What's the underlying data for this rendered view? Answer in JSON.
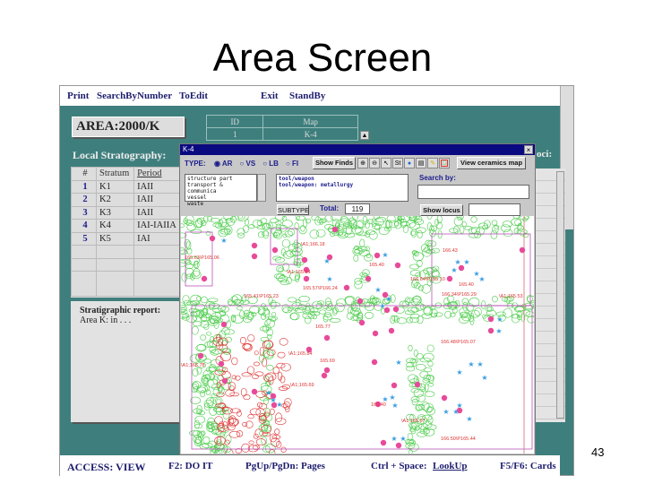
{
  "slide": {
    "title": "Area Screen",
    "page_number": "43"
  },
  "menu": [
    "Print",
    "SearchByNumber",
    "ToEdit",
    "Exit",
    "StandBy"
  ],
  "area": {
    "label": "AREA:",
    "value": "2000/K"
  },
  "map_table": {
    "headers": [
      "ID",
      "Map"
    ],
    "rows": [
      [
        "1",
        "K-4"
      ]
    ]
  },
  "local_strat": {
    "label": "Local Stratography:",
    "headers": [
      "#",
      "Stratum",
      "Period"
    ],
    "rows": [
      [
        "1",
        "K1",
        "IAII"
      ],
      [
        "2",
        "K2",
        "IAII"
      ],
      [
        "3",
        "K3",
        "IAII"
      ],
      [
        "4",
        "K4",
        "IAI-IAIIA"
      ],
      [
        "5",
        "K5",
        "IAI"
      ]
    ]
  },
  "report": {
    "label": "Stratigraphic report:",
    "text": "Area K: in . . ."
  },
  "loci_label": "oci:",
  "status": [
    "ACCESS: VIEW",
    "F2: DO IT",
    "PgUp/PgDn: Pages",
    "Ctrl + Space:",
    "LookUp",
    "F5/F6: Cards"
  ],
  "popup": {
    "title": "K-4",
    "close": "×",
    "type_label": "TYPE:",
    "types": [
      {
        "label": "AR",
        "checked": true
      },
      {
        "label": "VS",
        "checked": false
      },
      {
        "label": "LB",
        "checked": false
      },
      {
        "label": "FI",
        "checked": false
      }
    ],
    "show_finds": "Show Finds",
    "tools": [
      "zoom-in",
      "zoom-out",
      "pointer",
      "St",
      "globe",
      "print",
      "pencil",
      "frame"
    ],
    "view_ceramics": "View ceramics map",
    "categories": [
      "structure part",
      "transport & communica",
      "vessel",
      "waste"
    ],
    "subtypes": [
      "tool/weapon",
      "tool/weapon: metallurgy"
    ],
    "subtype_btn": "SUBTYPE",
    "total_label": "Total:",
    "total": "119",
    "search_by": "Search by:",
    "search_value": "",
    "show_locus": "Show locus",
    "locus_value": "",
    "map_labels": [
      "\\A1;166.18",
      "165.40",
      "165.63\\P165.06",
      "\\A1;165.84",
      "166.84\\P165.10",
      "166.43",
      "165.40",
      "165.57\\P166.24",
      "165.41\\P165.23",
      "166.34\\P165.29",
      "\\A1;165.53",
      "165.77",
      "\\A1;165.84",
      "166.48\\P165.07",
      "165.69",
      "\\A1;165.69",
      "\\A1;165.78",
      "165.40",
      "166.50\\P165.44",
      "\\A1;165.67"
    ]
  },
  "colors": {
    "teal": "#3e7f7d",
    "navy": "#0a0a80",
    "pink": "#e84a9a",
    "green": "#4ccc4c",
    "red": "#d33",
    "star": "#3a9ee0"
  }
}
